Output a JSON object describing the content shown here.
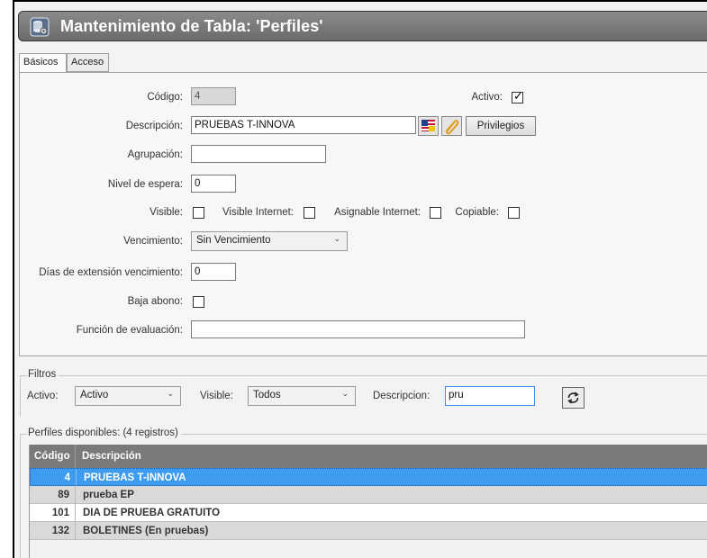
{
  "window": {
    "title": "Mantenimiento de Tabla: 'Perfiles'"
  },
  "tabs": [
    {
      "label": "Básicos",
      "active": true
    },
    {
      "label": "Acceso",
      "active": false
    }
  ],
  "form": {
    "codigo": {
      "label": "Código:",
      "value": "4"
    },
    "activo": {
      "label": "Activo:",
      "checked": true
    },
    "descripcion": {
      "label": "Descripción:",
      "value": "PRUEBAS T-INNOVA"
    },
    "privilegios_button": "Privilegios",
    "agrupacion": {
      "label": "Agrupación:",
      "value": ""
    },
    "nivel_espera": {
      "label": "Nivel de espera:",
      "value": "0"
    },
    "visible": {
      "label": "Visible:",
      "checked": false
    },
    "visible_internet": {
      "label": "Visible Internet:",
      "checked": false
    },
    "asignable_internet": {
      "label": "Asignable Internet:",
      "checked": false
    },
    "copiable": {
      "label": "Copiable:",
      "checked": false
    },
    "vencimiento": {
      "label": "Vencimiento:",
      "value": "Sin Vencimiento"
    },
    "dias_extension": {
      "label": "Días de extensión vencimiento:",
      "value": "0"
    },
    "baja_abono": {
      "label": "Baja abono:",
      "checked": false
    },
    "funcion_evaluacion": {
      "label": "Función de evaluación:",
      "value": ""
    }
  },
  "filters": {
    "legend": "Filtros",
    "activo": {
      "label": "Activo:",
      "value": "Activo"
    },
    "visible": {
      "label": "Visible:",
      "value": "Todos"
    },
    "descripcion": {
      "label": "Descripcion:",
      "value": "pru"
    }
  },
  "profiles": {
    "legend": "Perfiles disponibles:  (4 registros)",
    "columns": [
      "Código",
      "Descripción"
    ],
    "rows": [
      {
        "codigo": "4",
        "descripcion": "PRUEBAS T-INNOVA",
        "selected": true
      },
      {
        "codigo": "89",
        "descripcion": "prueba EP",
        "selected": false
      },
      {
        "codigo": "101",
        "descripcion": "DIA DE PRUEBA GRATUITO",
        "selected": false
      },
      {
        "codigo": "132",
        "descripcion": "BOLETINES (En pruebas)",
        "selected": false
      }
    ]
  },
  "colors": {
    "selected_row": "#3d9cf0",
    "header": "#7a7a7a",
    "titlebar": "#7a7a7a"
  }
}
